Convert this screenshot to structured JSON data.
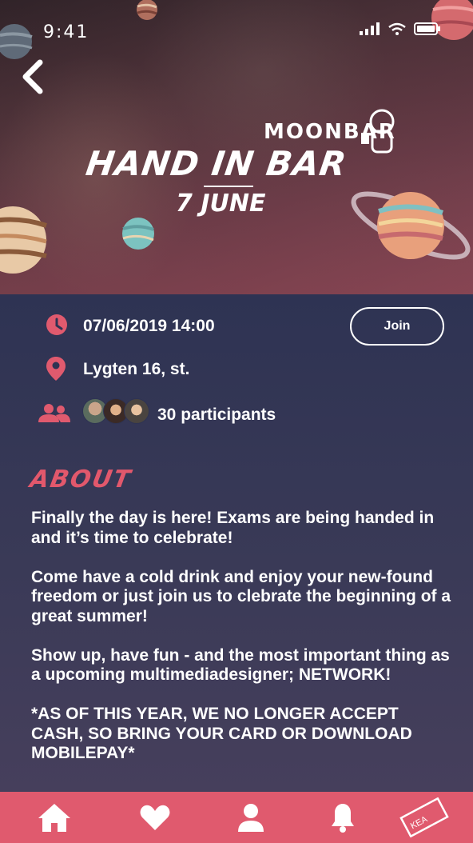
{
  "status_bar": {
    "time": "9:41"
  },
  "hero": {
    "brand": "MOONBAR",
    "title": "HAND IN BAR",
    "date_art": "7 JUNE"
  },
  "event": {
    "datetime": "07/06/2019 14:00",
    "location": "Lygten 16, st.",
    "participants": "30 participants",
    "join_label": "Join"
  },
  "about": {
    "heading": "ABOUT",
    "paragraphs": [
      "Finally the day is here! Exams are being handed in and it’s time to celebrate!",
      "Come have a cold drink and enjoy your new-found freedom or just join us to clebrate the beginning of a great summer!",
      "Show up, have fun - and the most important thing as a upcoming multimediadesigner; NETWORK!",
      "*AS OF THIS YEAR, WE NO LONGER ACCEPT CASH, SO BRING YOUR CARD OR DOWNLOAD MOBILEPAY*"
    ]
  },
  "tabbar": {
    "kea_label": "KEA",
    "items": [
      "home-icon",
      "heart-icon",
      "user-icon",
      "bell-icon",
      "kea-ticket-icon"
    ]
  },
  "colors": {
    "accent": "#e05a6e",
    "background": "#2f3352",
    "text": "#ffffff"
  }
}
